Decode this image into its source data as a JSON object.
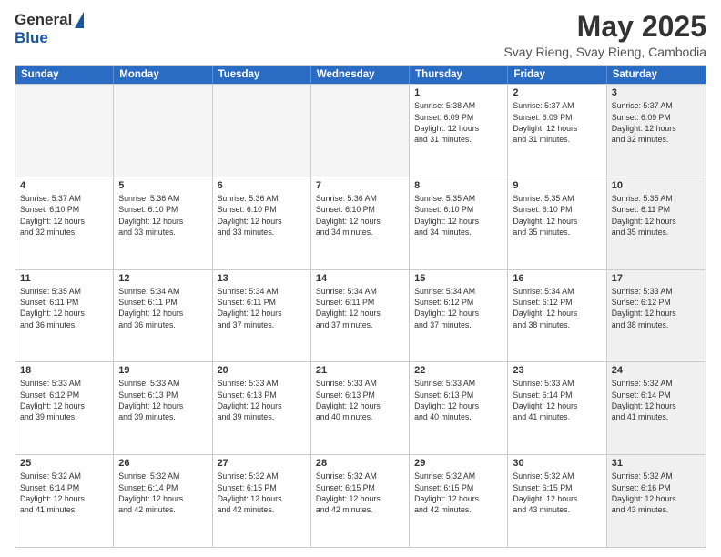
{
  "logo": {
    "general": "General",
    "blue": "Blue"
  },
  "header": {
    "month": "May 2025",
    "location": "Svay Rieng, Svay Rieng, Cambodia"
  },
  "weekdays": [
    "Sunday",
    "Monday",
    "Tuesday",
    "Wednesday",
    "Thursday",
    "Friday",
    "Saturday"
  ],
  "rows": [
    [
      {
        "day": "",
        "empty": true,
        "text": ""
      },
      {
        "day": "",
        "empty": true,
        "text": ""
      },
      {
        "day": "",
        "empty": true,
        "text": ""
      },
      {
        "day": "",
        "empty": true,
        "text": ""
      },
      {
        "day": "1",
        "text": "Sunrise: 5:38 AM\nSunset: 6:09 PM\nDaylight: 12 hours\nand 31 minutes."
      },
      {
        "day": "2",
        "text": "Sunrise: 5:37 AM\nSunset: 6:09 PM\nDaylight: 12 hours\nand 31 minutes."
      },
      {
        "day": "3",
        "shaded": true,
        "text": "Sunrise: 5:37 AM\nSunset: 6:09 PM\nDaylight: 12 hours\nand 32 minutes."
      }
    ],
    [
      {
        "day": "4",
        "text": "Sunrise: 5:37 AM\nSunset: 6:10 PM\nDaylight: 12 hours\nand 32 minutes."
      },
      {
        "day": "5",
        "text": "Sunrise: 5:36 AM\nSunset: 6:10 PM\nDaylight: 12 hours\nand 33 minutes."
      },
      {
        "day": "6",
        "text": "Sunrise: 5:36 AM\nSunset: 6:10 PM\nDaylight: 12 hours\nand 33 minutes."
      },
      {
        "day": "7",
        "text": "Sunrise: 5:36 AM\nSunset: 6:10 PM\nDaylight: 12 hours\nand 34 minutes."
      },
      {
        "day": "8",
        "text": "Sunrise: 5:35 AM\nSunset: 6:10 PM\nDaylight: 12 hours\nand 34 minutes."
      },
      {
        "day": "9",
        "text": "Sunrise: 5:35 AM\nSunset: 6:10 PM\nDaylight: 12 hours\nand 35 minutes."
      },
      {
        "day": "10",
        "shaded": true,
        "text": "Sunrise: 5:35 AM\nSunset: 6:11 PM\nDaylight: 12 hours\nand 35 minutes."
      }
    ],
    [
      {
        "day": "11",
        "text": "Sunrise: 5:35 AM\nSunset: 6:11 PM\nDaylight: 12 hours\nand 36 minutes."
      },
      {
        "day": "12",
        "text": "Sunrise: 5:34 AM\nSunset: 6:11 PM\nDaylight: 12 hours\nand 36 minutes."
      },
      {
        "day": "13",
        "text": "Sunrise: 5:34 AM\nSunset: 6:11 PM\nDaylight: 12 hours\nand 37 minutes."
      },
      {
        "day": "14",
        "text": "Sunrise: 5:34 AM\nSunset: 6:11 PM\nDaylight: 12 hours\nand 37 minutes."
      },
      {
        "day": "15",
        "text": "Sunrise: 5:34 AM\nSunset: 6:12 PM\nDaylight: 12 hours\nand 37 minutes."
      },
      {
        "day": "16",
        "text": "Sunrise: 5:34 AM\nSunset: 6:12 PM\nDaylight: 12 hours\nand 38 minutes."
      },
      {
        "day": "17",
        "shaded": true,
        "text": "Sunrise: 5:33 AM\nSunset: 6:12 PM\nDaylight: 12 hours\nand 38 minutes."
      }
    ],
    [
      {
        "day": "18",
        "text": "Sunrise: 5:33 AM\nSunset: 6:12 PM\nDaylight: 12 hours\nand 39 minutes."
      },
      {
        "day": "19",
        "text": "Sunrise: 5:33 AM\nSunset: 6:13 PM\nDaylight: 12 hours\nand 39 minutes."
      },
      {
        "day": "20",
        "text": "Sunrise: 5:33 AM\nSunset: 6:13 PM\nDaylight: 12 hours\nand 39 minutes."
      },
      {
        "day": "21",
        "text": "Sunrise: 5:33 AM\nSunset: 6:13 PM\nDaylight: 12 hours\nand 40 minutes."
      },
      {
        "day": "22",
        "text": "Sunrise: 5:33 AM\nSunset: 6:13 PM\nDaylight: 12 hours\nand 40 minutes."
      },
      {
        "day": "23",
        "text": "Sunrise: 5:33 AM\nSunset: 6:14 PM\nDaylight: 12 hours\nand 41 minutes."
      },
      {
        "day": "24",
        "shaded": true,
        "text": "Sunrise: 5:32 AM\nSunset: 6:14 PM\nDaylight: 12 hours\nand 41 minutes."
      }
    ],
    [
      {
        "day": "25",
        "text": "Sunrise: 5:32 AM\nSunset: 6:14 PM\nDaylight: 12 hours\nand 41 minutes."
      },
      {
        "day": "26",
        "text": "Sunrise: 5:32 AM\nSunset: 6:14 PM\nDaylight: 12 hours\nand 42 minutes."
      },
      {
        "day": "27",
        "text": "Sunrise: 5:32 AM\nSunset: 6:15 PM\nDaylight: 12 hours\nand 42 minutes."
      },
      {
        "day": "28",
        "text": "Sunrise: 5:32 AM\nSunset: 6:15 PM\nDaylight: 12 hours\nand 42 minutes."
      },
      {
        "day": "29",
        "text": "Sunrise: 5:32 AM\nSunset: 6:15 PM\nDaylight: 12 hours\nand 42 minutes."
      },
      {
        "day": "30",
        "text": "Sunrise: 5:32 AM\nSunset: 6:15 PM\nDaylight: 12 hours\nand 43 minutes."
      },
      {
        "day": "31",
        "shaded": true,
        "text": "Sunrise: 5:32 AM\nSunset: 6:16 PM\nDaylight: 12 hours\nand 43 minutes."
      }
    ]
  ]
}
